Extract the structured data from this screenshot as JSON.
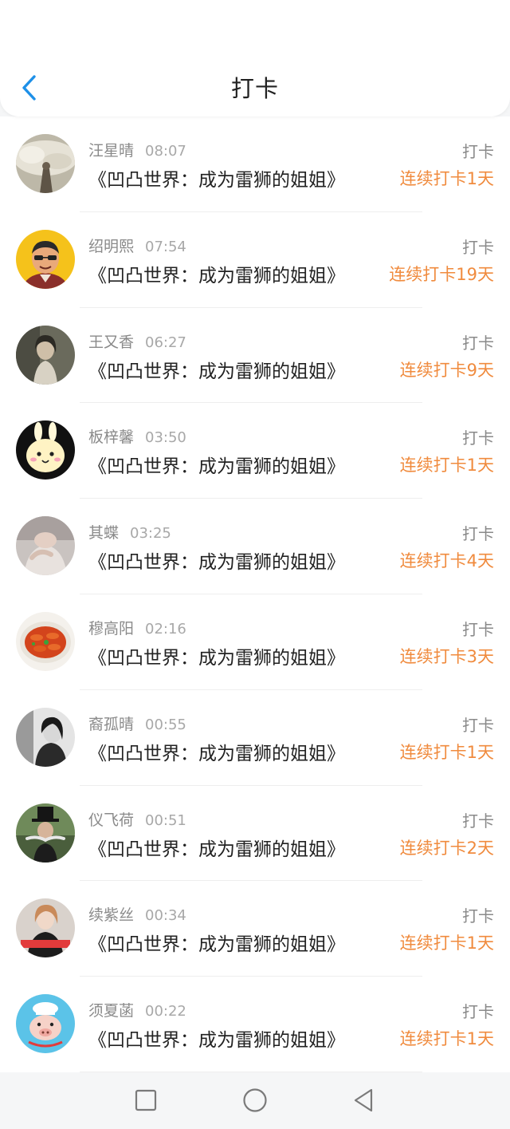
{
  "header": {
    "title": "打卡"
  },
  "list": {
    "items": [
      {
        "name": "汪星晴",
        "time": "08:07",
        "book": "《凹凸世界：成为雷狮的姐姐》",
        "action": "打卡",
        "streak": "连续打卡1天",
        "avatar": "avatar-cloud-photo"
      },
      {
        "name": "绍明熙",
        "time": "07:54",
        "book": "《凹凸世界：成为雷狮的姐姐》",
        "action": "打卡",
        "streak": "连续打卡19天",
        "avatar": "avatar-cartoon-man"
      },
      {
        "name": "王又香",
        "time": "06:27",
        "book": "《凹凸世界：成为雷狮的姐姐》",
        "action": "打卡",
        "streak": "连续打卡9天",
        "avatar": "avatar-woman-photo"
      },
      {
        "name": "板梓馨",
        "time": "03:50",
        "book": "《凹凸世界：成为雷狮的姐姐》",
        "action": "打卡",
        "streak": "连续打卡1天",
        "avatar": "avatar-bunny-cartoon"
      },
      {
        "name": "其蝶",
        "time": "03:25",
        "book": "《凹凸世界：成为雷狮的姐姐》",
        "action": "打卡",
        "streak": "连续打卡4天",
        "avatar": "avatar-hands-photo"
      },
      {
        "name": "穆高阳",
        "time": "02:16",
        "book": "《凹凸世界：成为雷狮的姐姐》",
        "action": "打卡",
        "streak": "连续打卡3天",
        "avatar": "avatar-food-photo"
      },
      {
        "name": "裔孤晴",
        "time": "00:55",
        "book": "《凹凸世界：成为雷狮的姐姐》",
        "action": "打卡",
        "streak": "连续打卡1天",
        "avatar": "avatar-bw-portrait"
      },
      {
        "name": "仪飞荷",
        "time": "00:51",
        "book": "《凹凸世界：成为雷狮的姐姐》",
        "action": "打卡",
        "streak": "连续打卡2天",
        "avatar": "avatar-top-hat-man"
      },
      {
        "name": "续紫丝",
        "time": "00:34",
        "book": "《凹凸世界：成为雷狮的姐姐》",
        "action": "打卡",
        "streak": "连续打卡1天",
        "avatar": "avatar-girl-photo"
      },
      {
        "name": "须夏菡",
        "time": "00:22",
        "book": "《凹凸世界：成为雷狮的姐姐》",
        "action": "打卡",
        "streak": "连续打卡1天",
        "avatar": "avatar-chef-pig-cartoon"
      }
    ]
  },
  "icons": {
    "back": "chevron-left-icon",
    "nav_recents": "square-icon",
    "nav_home": "circle-icon",
    "nav_back": "triangle-back-icon"
  },
  "colors": {
    "accent_blue": "#1e90e8",
    "streak_orange": "#f08b3e",
    "text_primary": "#222222",
    "text_secondary": "#8a8a8a"
  }
}
